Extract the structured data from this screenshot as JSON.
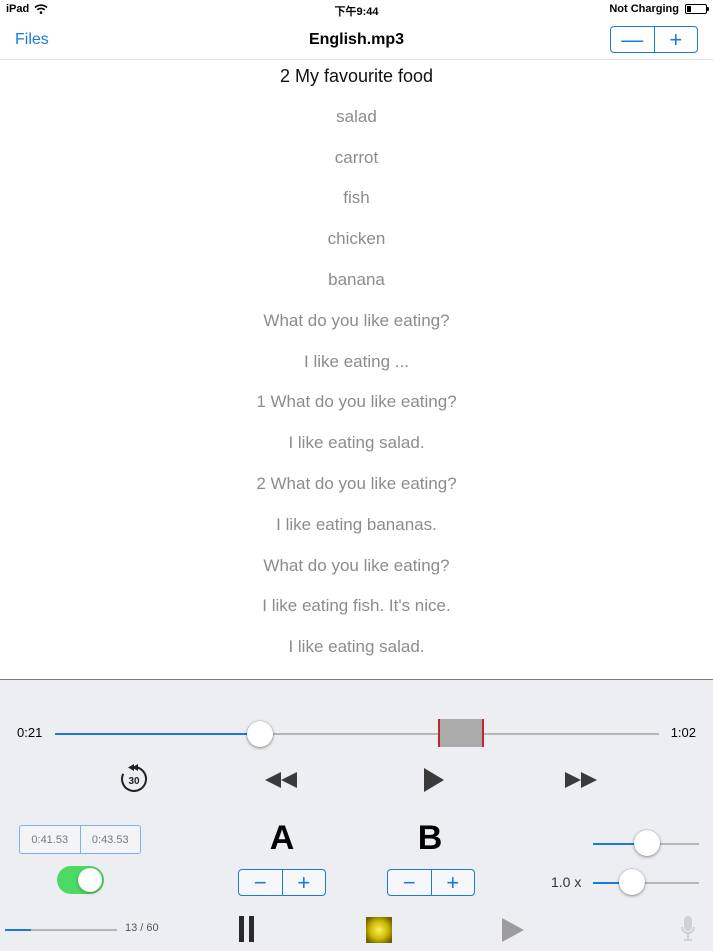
{
  "status_bar": {
    "device": "iPad",
    "time": "下午9:44",
    "charging": "Not Charging"
  },
  "nav": {
    "back_label": "Files",
    "title": "English.mp3",
    "zoom_out_label": "—",
    "zoom_in_label": "+"
  },
  "lyrics": {
    "current_index": 0,
    "lines": [
      "2 My favourite food",
      "salad",
      "carrot",
      "fish",
      "chicken",
      "banana",
      "What do you like eating?",
      "I like eating ...",
      "1 What do you like eating?",
      "I like eating salad.",
      "2 What do you like eating?",
      "I like eating bananas.",
      "What do you like eating?",
      "I like eating fish. It's nice.",
      "I like eating salad."
    ]
  },
  "player": {
    "elapsed": "0:21",
    "duration": "1:02",
    "progress_fraction": 0.3387,
    "skip_back_seconds": "30",
    "point_a_time": "0:41.53",
    "point_b_time": "0:43.53",
    "loop_enabled": true,
    "a_label": "A",
    "b_label": "B",
    "stepper_minus": "−",
    "stepper_plus": "+",
    "speed_label": "1.0 x",
    "track_counter": "13 / 60",
    "accent_color": "#1a7bdc",
    "marker_color": "#c0262b",
    "toggle_color": "#4cd964"
  },
  "icons": {
    "wifi": "wifi-icon",
    "battery": "battery-icon",
    "replay_30": "replay-30-icon",
    "rewind": "rewind-icon",
    "play": "play-icon",
    "fast_forward": "fast-forward-icon",
    "pause": "pause-icon",
    "stop": "stop-icon",
    "play_sentence": "play-sentence-icon",
    "microphone": "microphone-icon"
  }
}
